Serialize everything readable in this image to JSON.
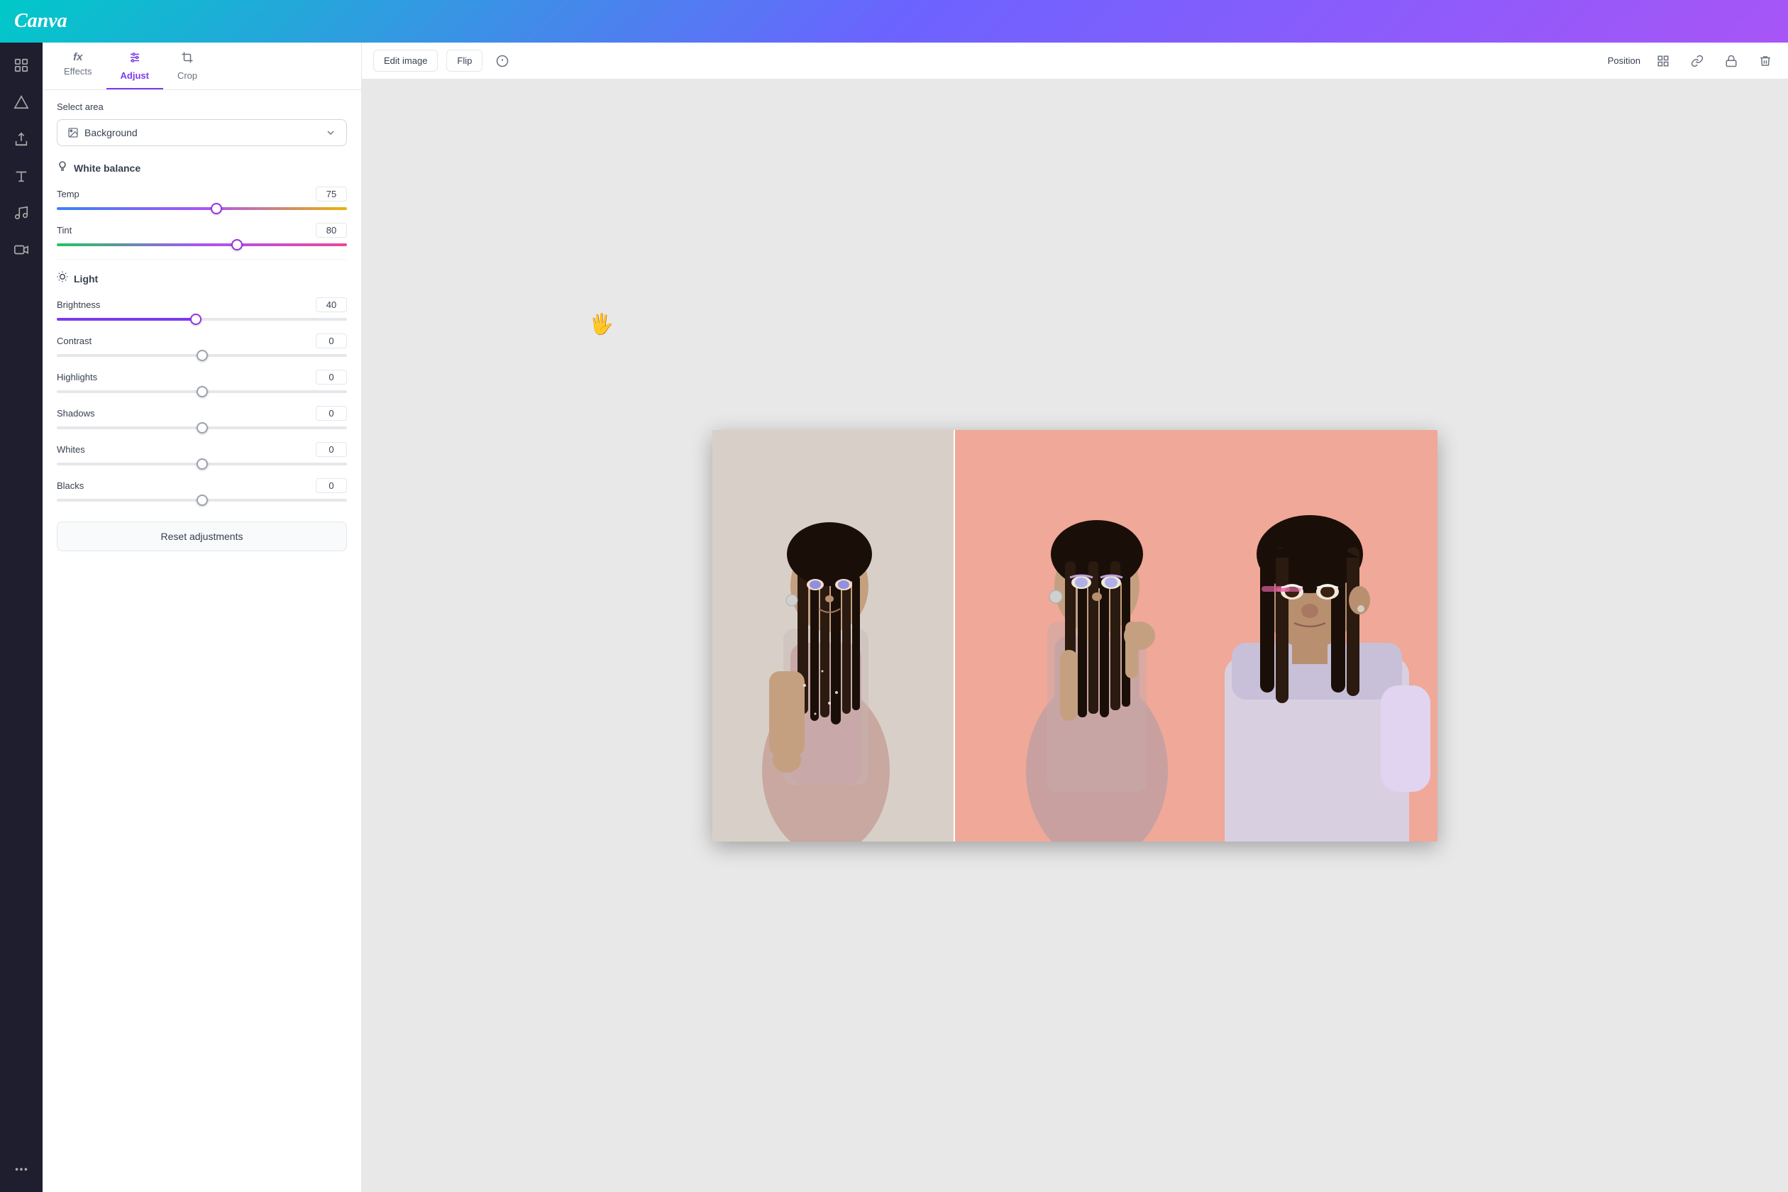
{
  "header": {
    "logo": "Canva"
  },
  "sidebar": {
    "icons": [
      {
        "name": "layout-icon",
        "symbol": "⊞",
        "active": false
      },
      {
        "name": "shapes-icon",
        "symbol": "◇",
        "active": false
      },
      {
        "name": "upload-icon",
        "symbol": "↑",
        "active": false
      },
      {
        "name": "text-icon",
        "symbol": "T",
        "active": false
      },
      {
        "name": "music-icon",
        "symbol": "♪",
        "active": false
      },
      {
        "name": "video-icon",
        "symbol": "▷",
        "active": false
      },
      {
        "name": "more-icon",
        "symbol": "···",
        "active": false
      }
    ]
  },
  "tabs": {
    "effects": {
      "label": "Effects",
      "icon": "fx"
    },
    "adjust": {
      "label": "Adjust",
      "active": true
    },
    "crop": {
      "label": "Crop",
      "icon": "crop"
    }
  },
  "panel": {
    "select_area_label": "Select area",
    "select_dropdown_value": "Background",
    "white_balance_title": "White balance",
    "temp_label": "Temp",
    "temp_value": "75",
    "temp_position_pct": 55,
    "tint_label": "Tint",
    "tint_value": "80",
    "tint_position_pct": 62,
    "light_title": "Light",
    "brightness_label": "Brightness",
    "brightness_value": "40",
    "brightness_position_pct": 48,
    "contrast_label": "Contrast",
    "contrast_value": "0",
    "contrast_position_pct": 50,
    "highlights_label": "Highlights",
    "highlights_value": "0",
    "highlights_position_pct": 50,
    "shadows_label": "Shadows",
    "shadows_value": "0",
    "shadows_position_pct": 50,
    "whites_label": "Whites",
    "whites_value": "0",
    "whites_position_pct": 50,
    "blacks_label": "Blacks",
    "blacks_value": "0",
    "blacks_position_pct": 50,
    "reset_label": "Reset adjustments"
  },
  "toolbar": {
    "edit_image_label": "Edit image",
    "flip_label": "Flip",
    "position_label": "Position"
  }
}
